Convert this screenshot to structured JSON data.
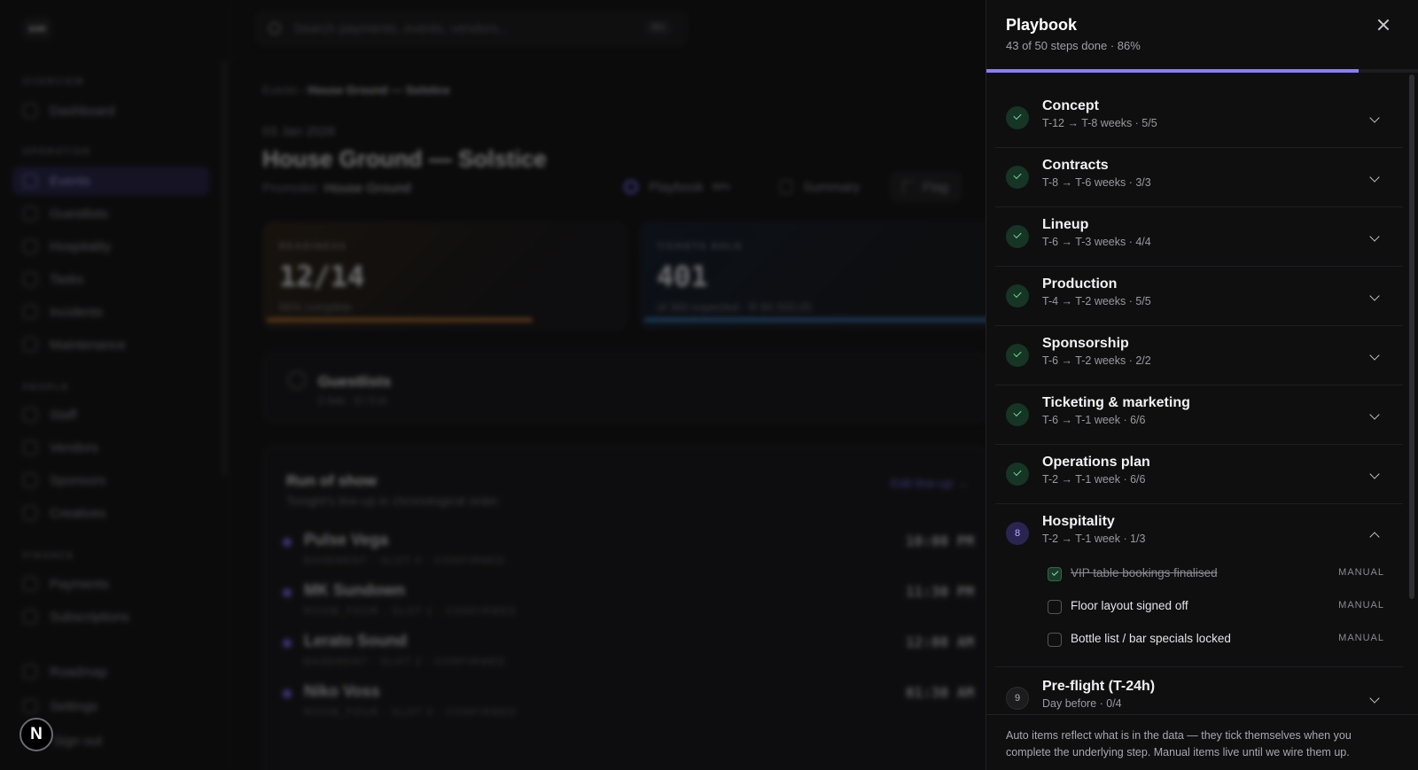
{
  "sidebar": {
    "logo": "arab",
    "sections": [
      {
        "label": "OVERVIEW",
        "items": [
          {
            "label": "Dashboard"
          }
        ]
      },
      {
        "label": "OPERATION",
        "items": [
          {
            "label": "Events",
            "active": true
          },
          {
            "label": "Guestlists"
          },
          {
            "label": "Hospitality"
          },
          {
            "label": "Tasks"
          },
          {
            "label": "Incidents"
          },
          {
            "label": "Maintenance"
          }
        ]
      },
      {
        "label": "PEOPLE",
        "items": [
          {
            "label": "Staff"
          },
          {
            "label": "Vendors"
          },
          {
            "label": "Sponsors"
          },
          {
            "label": "Creatives"
          }
        ]
      },
      {
        "label": "FINANCE",
        "items": [
          {
            "label": "Payments"
          },
          {
            "label": "Subscriptions"
          }
        ]
      }
    ],
    "bottom_items": [
      {
        "label": "Roadmap"
      },
      {
        "label": "Settings"
      },
      {
        "label": "Sign out"
      }
    ],
    "avatar_letter": "N"
  },
  "search": {
    "placeholder": "Search payments, events, vendors...",
    "shortcut": "⌘K"
  },
  "event": {
    "breadcrumb_root": "Events",
    "breadcrumb_current": "House Ground — Solstice",
    "date": "03 Jan 2026",
    "title": "House Ground — Solstice",
    "promoter_label": "Promoter:",
    "promoter_name": "House Ground",
    "actions": {
      "playbook": "Playbook",
      "playbook_pct": "86%",
      "summary": "Summary",
      "flag": "Flag"
    },
    "cards": [
      {
        "label": "READINESS",
        "value": "12/14",
        "sub": "86% complete",
        "progress": 0.86
      },
      {
        "label": "TICKETS SOLD",
        "value": "401",
        "sub": "of 360 expected · R 84 500,00",
        "progress": 1.0
      }
    ],
    "guestlists": {
      "title": "Guestlists",
      "sub": "2 lists · 0 / 0 in"
    },
    "run_of_show": {
      "title": "Run of show",
      "sub": "Tonight's line-up in chronological order.",
      "edit_link": "Edit line-up →",
      "rows": [
        {
          "name": "Pulse Vega",
          "meta": "BASEMENT · SLOT 0 · CONFIRMED",
          "time": "10:00 PM"
        },
        {
          "name": "MK Sundown",
          "meta": "ROOM_FOUR · SLOT 1 · CONFIRMED",
          "time": "11:30 PM"
        },
        {
          "name": "Lerato Sound",
          "meta": "BASEMENT · SLOT 2 · CONFIRMED",
          "time": "12:00 AM"
        },
        {
          "name": "Niko Voss",
          "meta": "ROOM_FOUR · SLOT 3 · CONFIRMED",
          "time": "01:30 AM"
        }
      ]
    }
  },
  "playbook": {
    "title": "Playbook",
    "summary": "43 of 50 steps done · 86%",
    "progress": 0.86,
    "steps": [
      {
        "name": "Concept",
        "meta": "T-12 → T-8 weeks · 5/5",
        "done": true
      },
      {
        "name": "Contracts",
        "meta": "T-8 → T-6 weeks · 3/3",
        "done": true
      },
      {
        "name": "Lineup",
        "meta": "T-6 → T-3 weeks · 4/4",
        "done": true
      },
      {
        "name": "Production",
        "meta": "T-4 → T-2 weeks · 5/5",
        "done": true
      },
      {
        "name": "Sponsorship",
        "meta": "T-6 → T-2 weeks · 2/2",
        "done": true
      },
      {
        "name": "Ticketing & marketing",
        "meta": "T-6 → T-1 week · 6/6",
        "done": true
      },
      {
        "name": "Operations plan",
        "meta": "T-2 → T-1 week · 6/6",
        "done": true
      },
      {
        "name": "Hospitality",
        "meta": "T-2 → T-1 week · 1/3",
        "done": false,
        "number": "8",
        "expanded": true,
        "tasks": [
          {
            "label": "VIP table bookings finalised",
            "tag": "MANUAL",
            "checked": true
          },
          {
            "label": "Floor layout signed off",
            "tag": "MANUAL",
            "checked": false
          },
          {
            "label": "Bottle list / bar specials locked",
            "tag": "MANUAL",
            "checked": false
          }
        ]
      },
      {
        "name": "Pre-flight (T-24h)",
        "meta": "Day before · 0/4",
        "done": false,
        "number": "9"
      }
    ],
    "footer": "Auto items reflect what is in the data — they tick themselves when you complete the underlying step. Manual items live until we wire them up."
  },
  "colors": {
    "accent": "#8b7cff",
    "success": "#6fd39a",
    "readiness_bar": "#e0892a",
    "tickets_bar": "#3d8fe0"
  }
}
